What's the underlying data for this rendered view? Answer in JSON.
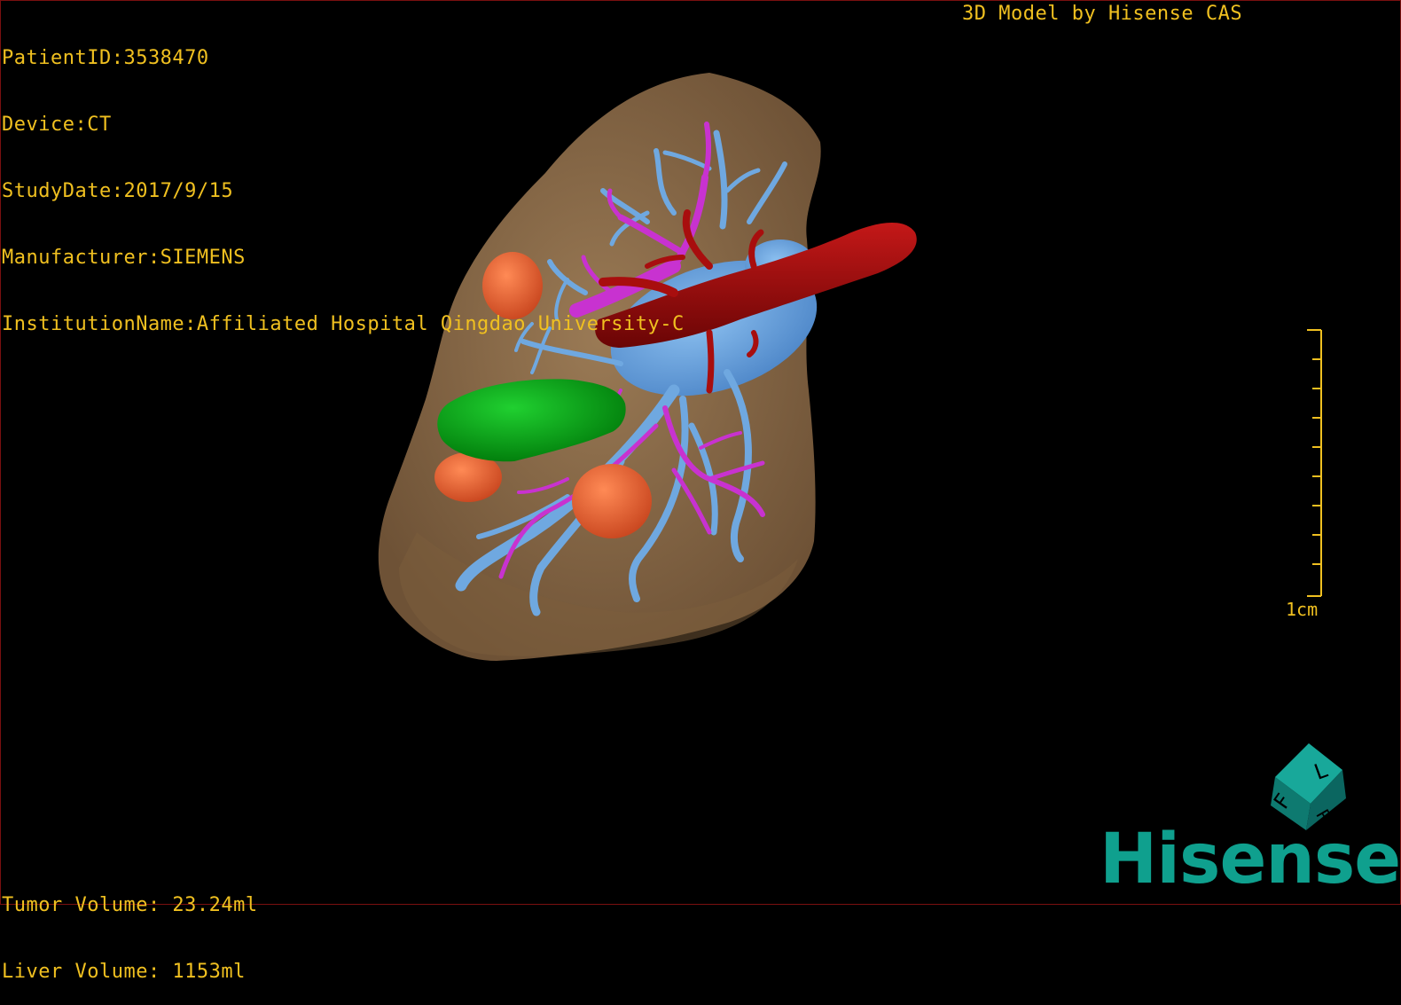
{
  "header": {
    "patient_id": "PatientID:3538470",
    "device": "Device:CT",
    "study_date": "StudyDate:2017/9/15",
    "manufacturer": "Manufacturer:SIEMENS",
    "institution": "InstitutionName:Affiliated Hospital Qingdao University-C"
  },
  "watermark": "3D Model by Hisense CAS",
  "volumes": {
    "tumor": "Tumor Volume: 23.24ml",
    "liver": "Liver Volume: 1153ml"
  },
  "scale": {
    "label": "1cm"
  },
  "orientation_cube": {
    "letters": [
      "F",
      "L",
      "R"
    ]
  },
  "logo": "Hisense",
  "colors": {
    "hud_text": "#f0c020",
    "liver": "#8a6a45",
    "portal_vein": "#6fa8e0",
    "hepatic_artery": "#c832d0",
    "vena_cava": "#9c0c0c",
    "tumor": "#00a010",
    "lesion": "#f06a3a",
    "logo": "#0fa08e"
  }
}
